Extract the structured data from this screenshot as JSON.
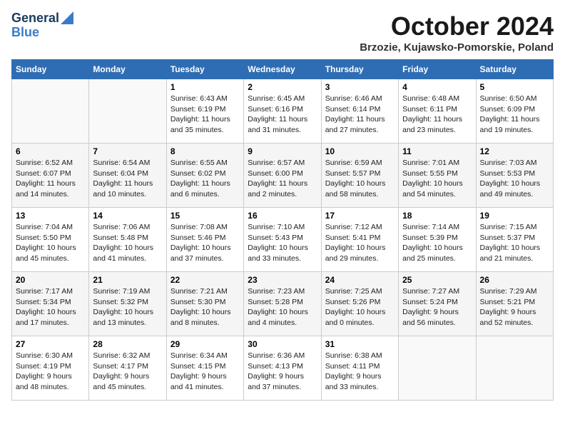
{
  "logo": {
    "general": "General",
    "blue": "Blue"
  },
  "title": "October 2024",
  "location": "Brzozie, Kujawsko-Pomorskie, Poland",
  "headers": [
    "Sunday",
    "Monday",
    "Tuesday",
    "Wednesday",
    "Thursday",
    "Friday",
    "Saturday"
  ],
  "weeks": [
    [
      {
        "day": "",
        "info": ""
      },
      {
        "day": "",
        "info": ""
      },
      {
        "day": "1",
        "info": "Sunrise: 6:43 AM\nSunset: 6:19 PM\nDaylight: 11 hours\nand 35 minutes."
      },
      {
        "day": "2",
        "info": "Sunrise: 6:45 AM\nSunset: 6:16 PM\nDaylight: 11 hours\nand 31 minutes."
      },
      {
        "day": "3",
        "info": "Sunrise: 6:46 AM\nSunset: 6:14 PM\nDaylight: 11 hours\nand 27 minutes."
      },
      {
        "day": "4",
        "info": "Sunrise: 6:48 AM\nSunset: 6:11 PM\nDaylight: 11 hours\nand 23 minutes."
      },
      {
        "day": "5",
        "info": "Sunrise: 6:50 AM\nSunset: 6:09 PM\nDaylight: 11 hours\nand 19 minutes."
      }
    ],
    [
      {
        "day": "6",
        "info": "Sunrise: 6:52 AM\nSunset: 6:07 PM\nDaylight: 11 hours\nand 14 minutes."
      },
      {
        "day": "7",
        "info": "Sunrise: 6:54 AM\nSunset: 6:04 PM\nDaylight: 11 hours\nand 10 minutes."
      },
      {
        "day": "8",
        "info": "Sunrise: 6:55 AM\nSunset: 6:02 PM\nDaylight: 11 hours\nand 6 minutes."
      },
      {
        "day": "9",
        "info": "Sunrise: 6:57 AM\nSunset: 6:00 PM\nDaylight: 11 hours\nand 2 minutes."
      },
      {
        "day": "10",
        "info": "Sunrise: 6:59 AM\nSunset: 5:57 PM\nDaylight: 10 hours\nand 58 minutes."
      },
      {
        "day": "11",
        "info": "Sunrise: 7:01 AM\nSunset: 5:55 PM\nDaylight: 10 hours\nand 54 minutes."
      },
      {
        "day": "12",
        "info": "Sunrise: 7:03 AM\nSunset: 5:53 PM\nDaylight: 10 hours\nand 49 minutes."
      }
    ],
    [
      {
        "day": "13",
        "info": "Sunrise: 7:04 AM\nSunset: 5:50 PM\nDaylight: 10 hours\nand 45 minutes."
      },
      {
        "day": "14",
        "info": "Sunrise: 7:06 AM\nSunset: 5:48 PM\nDaylight: 10 hours\nand 41 minutes."
      },
      {
        "day": "15",
        "info": "Sunrise: 7:08 AM\nSunset: 5:46 PM\nDaylight: 10 hours\nand 37 minutes."
      },
      {
        "day": "16",
        "info": "Sunrise: 7:10 AM\nSunset: 5:43 PM\nDaylight: 10 hours\nand 33 minutes."
      },
      {
        "day": "17",
        "info": "Sunrise: 7:12 AM\nSunset: 5:41 PM\nDaylight: 10 hours\nand 29 minutes."
      },
      {
        "day": "18",
        "info": "Sunrise: 7:14 AM\nSunset: 5:39 PM\nDaylight: 10 hours\nand 25 minutes."
      },
      {
        "day": "19",
        "info": "Sunrise: 7:15 AM\nSunset: 5:37 PM\nDaylight: 10 hours\nand 21 minutes."
      }
    ],
    [
      {
        "day": "20",
        "info": "Sunrise: 7:17 AM\nSunset: 5:34 PM\nDaylight: 10 hours\nand 17 minutes."
      },
      {
        "day": "21",
        "info": "Sunrise: 7:19 AM\nSunset: 5:32 PM\nDaylight: 10 hours\nand 13 minutes."
      },
      {
        "day": "22",
        "info": "Sunrise: 7:21 AM\nSunset: 5:30 PM\nDaylight: 10 hours\nand 8 minutes."
      },
      {
        "day": "23",
        "info": "Sunrise: 7:23 AM\nSunset: 5:28 PM\nDaylight: 10 hours\nand 4 minutes."
      },
      {
        "day": "24",
        "info": "Sunrise: 7:25 AM\nSunset: 5:26 PM\nDaylight: 10 hours\nand 0 minutes."
      },
      {
        "day": "25",
        "info": "Sunrise: 7:27 AM\nSunset: 5:24 PM\nDaylight: 9 hours\nand 56 minutes."
      },
      {
        "day": "26",
        "info": "Sunrise: 7:29 AM\nSunset: 5:21 PM\nDaylight: 9 hours\nand 52 minutes."
      }
    ],
    [
      {
        "day": "27",
        "info": "Sunrise: 6:30 AM\nSunset: 4:19 PM\nDaylight: 9 hours\nand 48 minutes."
      },
      {
        "day": "28",
        "info": "Sunrise: 6:32 AM\nSunset: 4:17 PM\nDaylight: 9 hours\nand 45 minutes."
      },
      {
        "day": "29",
        "info": "Sunrise: 6:34 AM\nSunset: 4:15 PM\nDaylight: 9 hours\nand 41 minutes."
      },
      {
        "day": "30",
        "info": "Sunrise: 6:36 AM\nSunset: 4:13 PM\nDaylight: 9 hours\nand 37 minutes."
      },
      {
        "day": "31",
        "info": "Sunrise: 6:38 AM\nSunset: 4:11 PM\nDaylight: 9 hours\nand 33 minutes."
      },
      {
        "day": "",
        "info": ""
      },
      {
        "day": "",
        "info": ""
      }
    ]
  ]
}
